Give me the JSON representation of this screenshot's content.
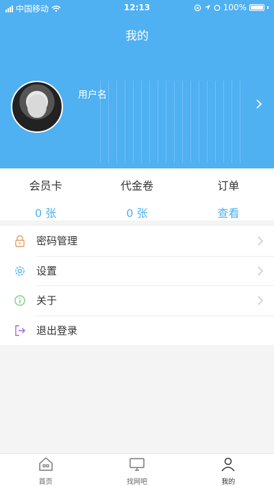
{
  "status_bar": {
    "carrier": "中国移动",
    "time": "12:13",
    "battery": "100%"
  },
  "header": {
    "title": "我的",
    "username": "用户名"
  },
  "stats": [
    {
      "label": "会员卡",
      "value": "0 张"
    },
    {
      "label": "代金卷",
      "value": "0 张"
    },
    {
      "label": "订单",
      "value": "查看"
    }
  ],
  "menu": [
    {
      "label": "密码管理",
      "icon": "lock-icon"
    },
    {
      "label": "设置",
      "icon": "gear-icon"
    },
    {
      "label": "关于",
      "icon": "info-icon"
    },
    {
      "label": "退出登录",
      "icon": "logout-icon"
    }
  ],
  "tabbar": [
    {
      "label": "首页",
      "icon": "home-icon"
    },
    {
      "label": "找网吧",
      "icon": "computer-icon"
    },
    {
      "label": "我的",
      "icon": "user-icon"
    }
  ],
  "colors": {
    "accent": "#4fb0f2",
    "background": "#f4f4f4"
  }
}
